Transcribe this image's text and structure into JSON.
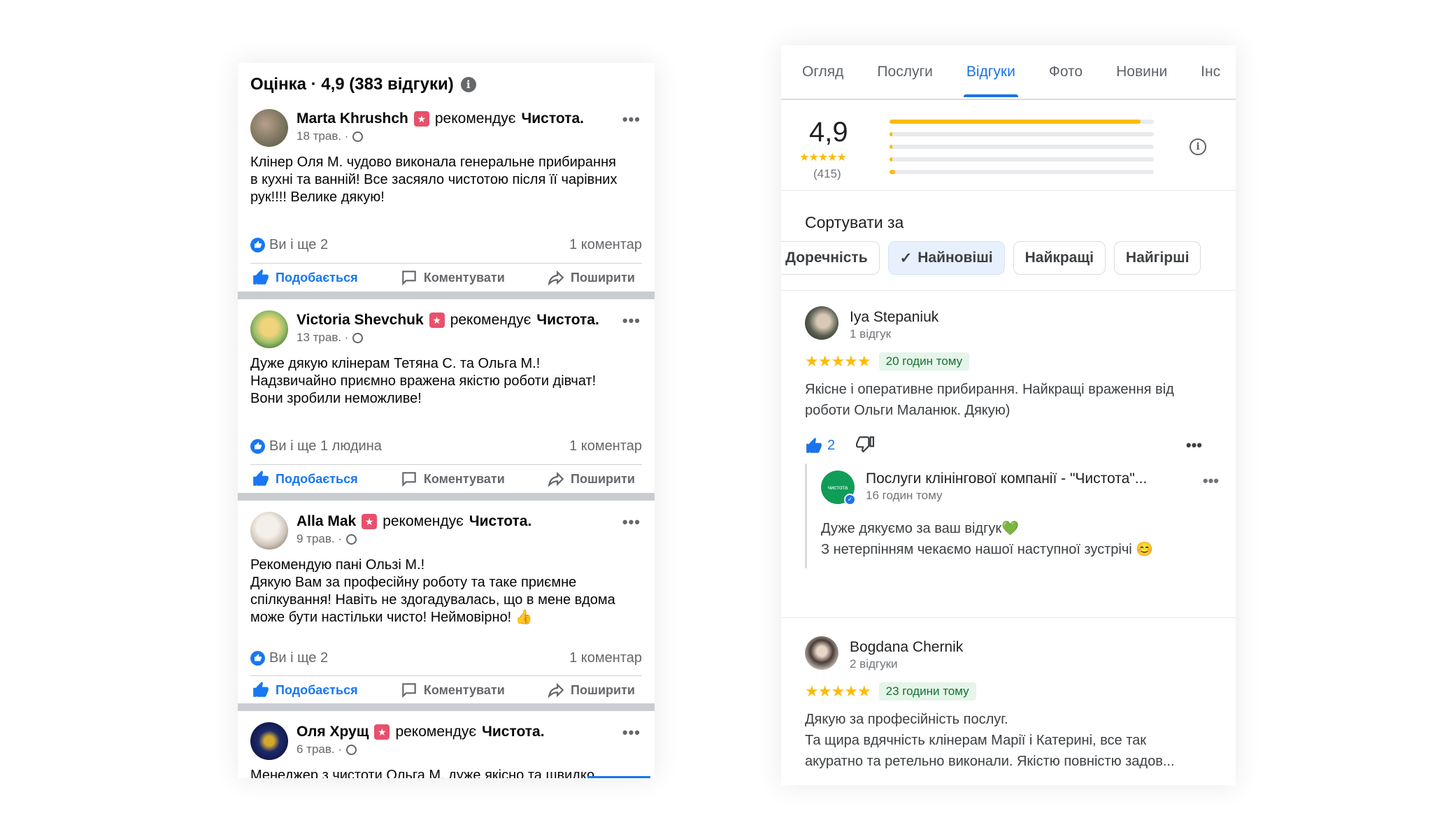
{
  "facebook": {
    "header": "Оцінка · 4,9 (383 відгуки)",
    "info_glyph": "i",
    "recommends": "рекомендує",
    "brand": "Чистота",
    "actions": {
      "like": "Подобається",
      "comment": "Коментувати",
      "share": "Поширити"
    },
    "posts": [
      {
        "name": "Marta  Khrushch",
        "date": "18 трав. ·",
        "text": "Клінер Оля М. чудово виконала генеральне прибирання\nв кухні та ванній! Все засяяло чистотою після її чарівних\nрук!!!! Велике дякую!",
        "likes": "Ви і ще 2",
        "comments": "1 коментар"
      },
      {
        "name": "Victoria Shevchuk",
        "date": "13 трав. ·",
        "text": "Дуже дякую клінерам Тетяна С. та Ольга М.!\nНадзвичайно приємно вражена якістю роботи дівчат!\nВони зробили неможливе!",
        "likes": "Ви і ще 1 людина",
        "comments": "1 коментар"
      },
      {
        "name": "Alla Mak",
        "date": "9 трав. ·",
        "text": "Рекомендую пані Ользі М.!\nДякую Вам за професійну роботу та таке приємне\nспілкування! Навіть не здогадувалась, що в мене вдома\nможе бути настільки чисто! Неймовірно! 👍",
        "likes": "Ви і ще 2",
        "comments": "1 коментар"
      },
      {
        "name": "Оля Хрущ",
        "date": "6 трав. ·",
        "text": "Менеджер з чистоти Ольга М. дуже якісно та швидко\nвпоралась з роботою! Рекомендую \"Чистоту\""
      }
    ]
  },
  "google": {
    "tabs": [
      "Огляд",
      "Послуги",
      "Відгуки",
      "Фото",
      "Новини",
      "Інс"
    ],
    "active_tab": "Відгуки",
    "rating": "4,9",
    "stars": "★★★★★",
    "count": "(415)",
    "rating_distribution": [
      0.95,
      0.01,
      0.01,
      0.01,
      0.02
    ],
    "info_glyph": "i",
    "sort_title": "Сортувати за",
    "sort_chips": [
      "Доречність",
      "Найновіші",
      "Найкращі",
      "Найгірші"
    ],
    "active_sort": "Найновіші",
    "check_glyph": "✓",
    "reviews": [
      {
        "name": "Iya Stepaniuk",
        "sub": "1 відгук",
        "stars": "★★★★★",
        "time": "20 годин тому",
        "text": "Якісне і оперативне прибирання. Найкращі враження від\nроботи Ольги Маланюк. Дякую)",
        "likes": "2",
        "reply": {
          "name": "Послуги клінінгової компанії - \"Чистота\"...",
          "time": "16 годин тому",
          "avatar_text": "чистота",
          "text": "Дуже дякуємо за ваш відгук💚\nЗ нетерпінням чекаємо нашої наступної зустрічі 😊"
        }
      },
      {
        "name": "Bogdana Chernik",
        "sub": "2 відгуки",
        "stars": "★★★★★",
        "time": "23 години тому",
        "text": "Дякую за професійність послуг.\nТа щира вдячність клінерам Марії і Катерині, все так\nакуратно та ретельно виконали. Якістю повністю задов..."
      }
    ],
    "colors": {
      "accent": "#1a73e8",
      "star": "#fbbc04",
      "time_bg": "#e6f4ea"
    }
  }
}
